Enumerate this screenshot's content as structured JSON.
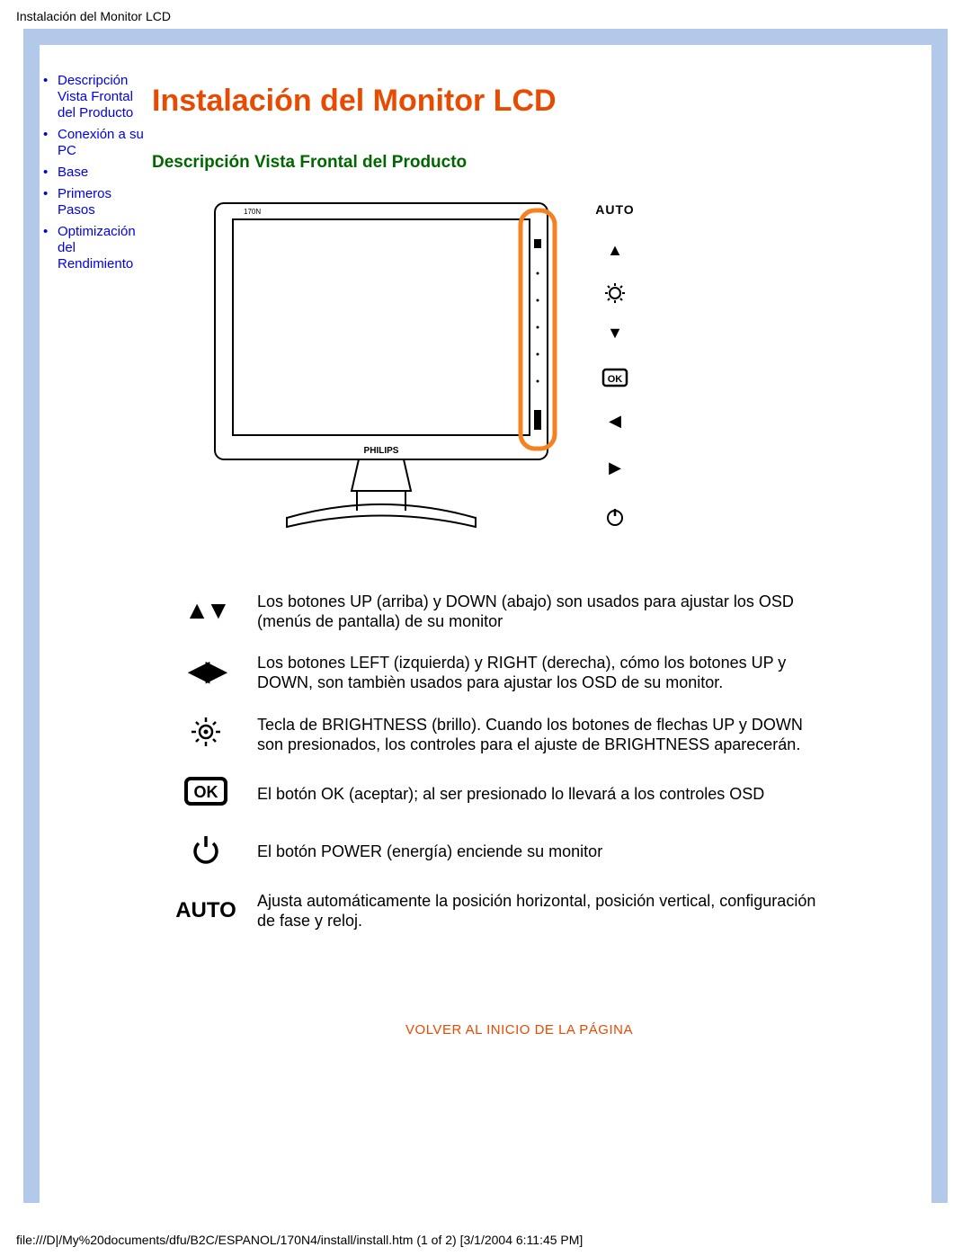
{
  "header_title": "Instalación del Monitor LCD",
  "sidebar": {
    "items": [
      {
        "label": "Descripción Vista Frontal del Producto"
      },
      {
        "label": "Conexión a su PC"
      },
      {
        "label": "Base"
      },
      {
        "label": "Primeros Pasos"
      },
      {
        "label": "Optimización del Rendimiento"
      }
    ]
  },
  "page_title": "Instalación del Monitor LCD",
  "section_title": "Descripción Vista Frontal del Producto",
  "icons_column": {
    "auto": "AUTO",
    "up": "▲",
    "brightness": "☼",
    "down": "▼",
    "ok": "OK",
    "left": "◀",
    "right": "▶",
    "power": "⏻"
  },
  "monitor_brand": "PHILIPS",
  "monitor_model": "170N",
  "legend": [
    {
      "icon": "updown",
      "text": "Los botones UP (arriba) y DOWN (abajo) son usados para ajustar los OSD (menús de pantalla) de su monitor"
    },
    {
      "icon": "leftright",
      "text": "Los botones LEFT (izquierda) y RIGHT (derecha), cómo los botones UP y DOWN, son tambièn usados para ajustar los OSD de su monitor."
    },
    {
      "icon": "brightness",
      "text": "Tecla de BRIGHTNESS (brillo). Cuando los botones de flechas UP y DOWN son presionados, los controles para el ajuste de BRIGHTNESS aparecerán."
    },
    {
      "icon": "ok",
      "text": "El botón OK (aceptar); al ser presionado lo llevará a los controles OSD"
    },
    {
      "icon": "power",
      "text": "El botón POWER (energía) enciende su monitor"
    },
    {
      "icon": "auto",
      "text": "Ajusta automáticamente la posición horizontal, posición vertical, configuración de fase y reloj."
    }
  ],
  "back_to_top": "VOLVER AL INICIO DE LA PÁGINA",
  "footer": "file:///D|/My%20documents/dfu/B2C/ESPANOL/170N4/install/install.htm (1 of 2) [3/1/2004 6:11:45 PM]"
}
